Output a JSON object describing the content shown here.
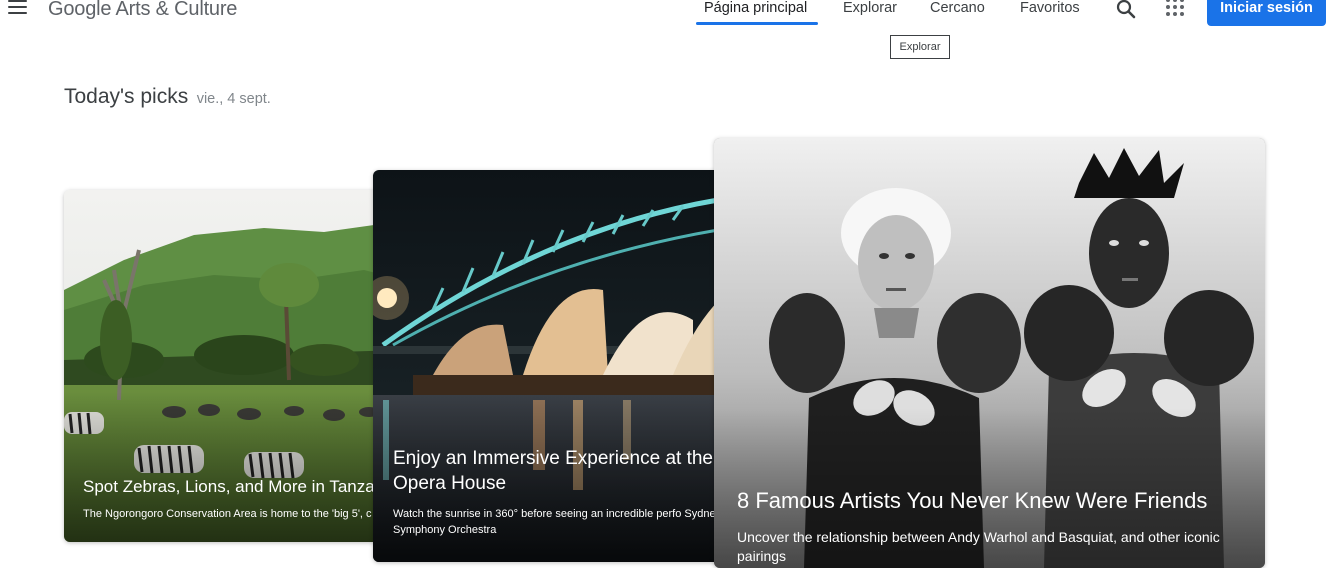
{
  "header": {
    "logo": "Google Arts & Culture",
    "nav": [
      {
        "label": "Página principal",
        "active": true
      },
      {
        "label": "Explorar",
        "active": false
      },
      {
        "label": "Cercano",
        "active": false
      },
      {
        "label": "Favoritos",
        "active": false
      }
    ],
    "signin_label": "Iniciar sesión",
    "tooltip": "Explorar",
    "icons": [
      "menu-icon",
      "search-icon",
      "apps-grid-icon"
    ],
    "accent_color": "#1a73e8"
  },
  "picks": {
    "title": "Today's picks",
    "date": "vie., 4 sept.",
    "cards": [
      {
        "title": "Spot Zebras, Lions, and More in Tanzan",
        "description": "The Ngorongoro Conservation Area is home to the 'big 5', c"
      },
      {
        "title": "Enjoy an Immersive Experience at the Opera House",
        "description": "Watch the sunrise in 360° before seeing an incredible perfo Sydney Symphony Orchestra"
      },
      {
        "title": "8 Famous Artists You Never Knew Were Friends",
        "description": "Uncover the relationship between Andy Warhol and Basquiat, and other iconic pairings"
      }
    ]
  }
}
